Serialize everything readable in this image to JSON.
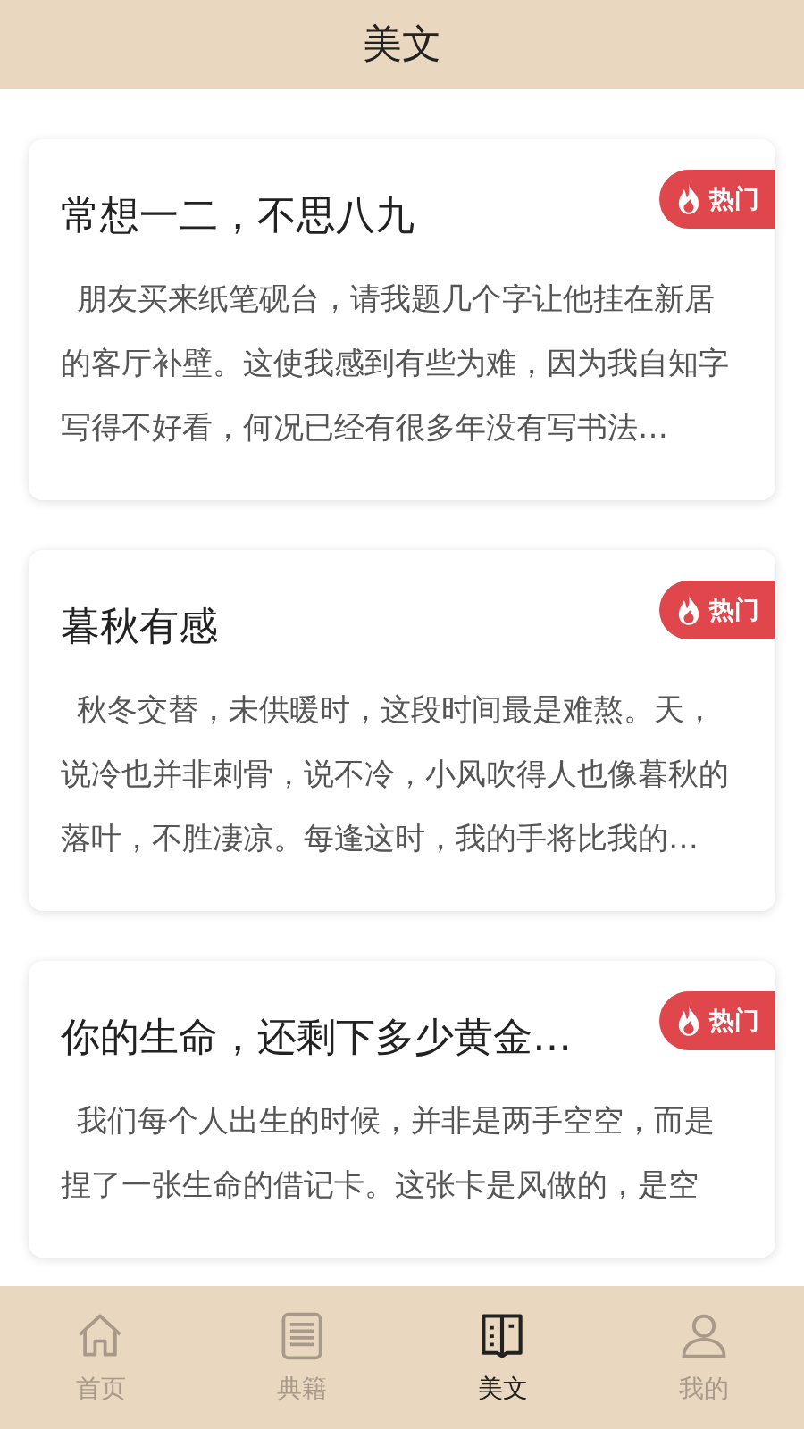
{
  "header": {
    "title": "美文"
  },
  "articles": [
    {
      "title": "常想一二，不思八九",
      "badge": "热门",
      "body": "朋友买来纸笔砚台，请我题几个字让他挂在新居的客厅补壁。这使我感到有些为难，因为我自知字写得不好看，何况已经有很多年没有写书法…"
    },
    {
      "title": "暮秋有感",
      "badge": "热门",
      "body": "秋冬交替，未供暖时，这段时间最是难熬。天，说冷也并非刺骨，说不冷，小风吹得人也像暮秋的落叶，不胜凄凉。每逢这时，我的手将比我的…"
    },
    {
      "title": "你的生命，还剩下多少黄金…",
      "badge": "热门",
      "body": "我们每个人出生的时候，并非是两手空空，而是捏了一张生命的借记卡。这张卡是风做的，是空"
    }
  ],
  "tabs": [
    {
      "label": "首页",
      "selected": false
    },
    {
      "label": "典籍",
      "selected": false
    },
    {
      "label": "美文",
      "selected": true
    },
    {
      "label": "我的",
      "selected": false
    }
  ]
}
